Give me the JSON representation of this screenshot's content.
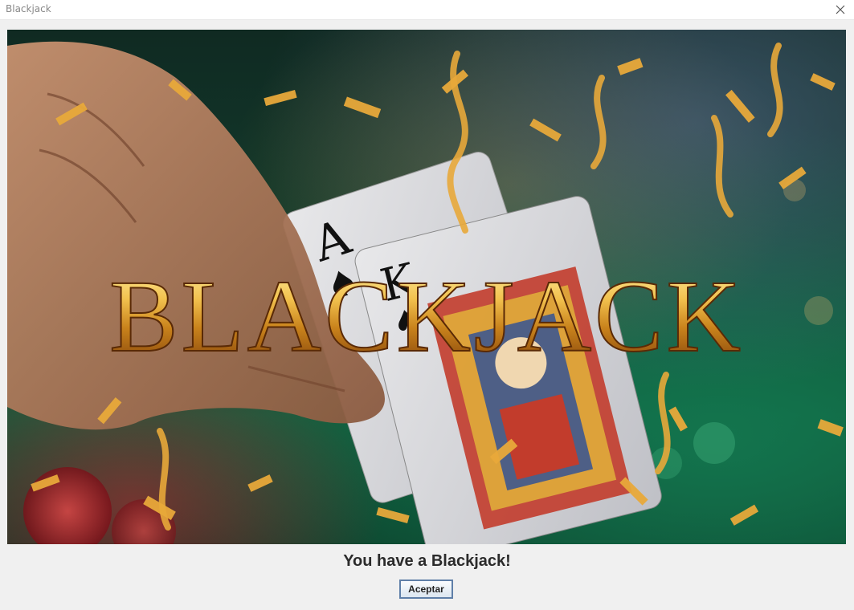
{
  "window": {
    "title": "Blackjack",
    "close_icon": "close-icon"
  },
  "banner": {
    "headline": "BLACKJACK",
    "card_1_rank": "A",
    "card_2_rank": "K",
    "suit_icon": "spade-icon",
    "accent_color": "#d4a030"
  },
  "dialog": {
    "message": "You have a Blackjack!",
    "accept_label": "Aceptar"
  }
}
